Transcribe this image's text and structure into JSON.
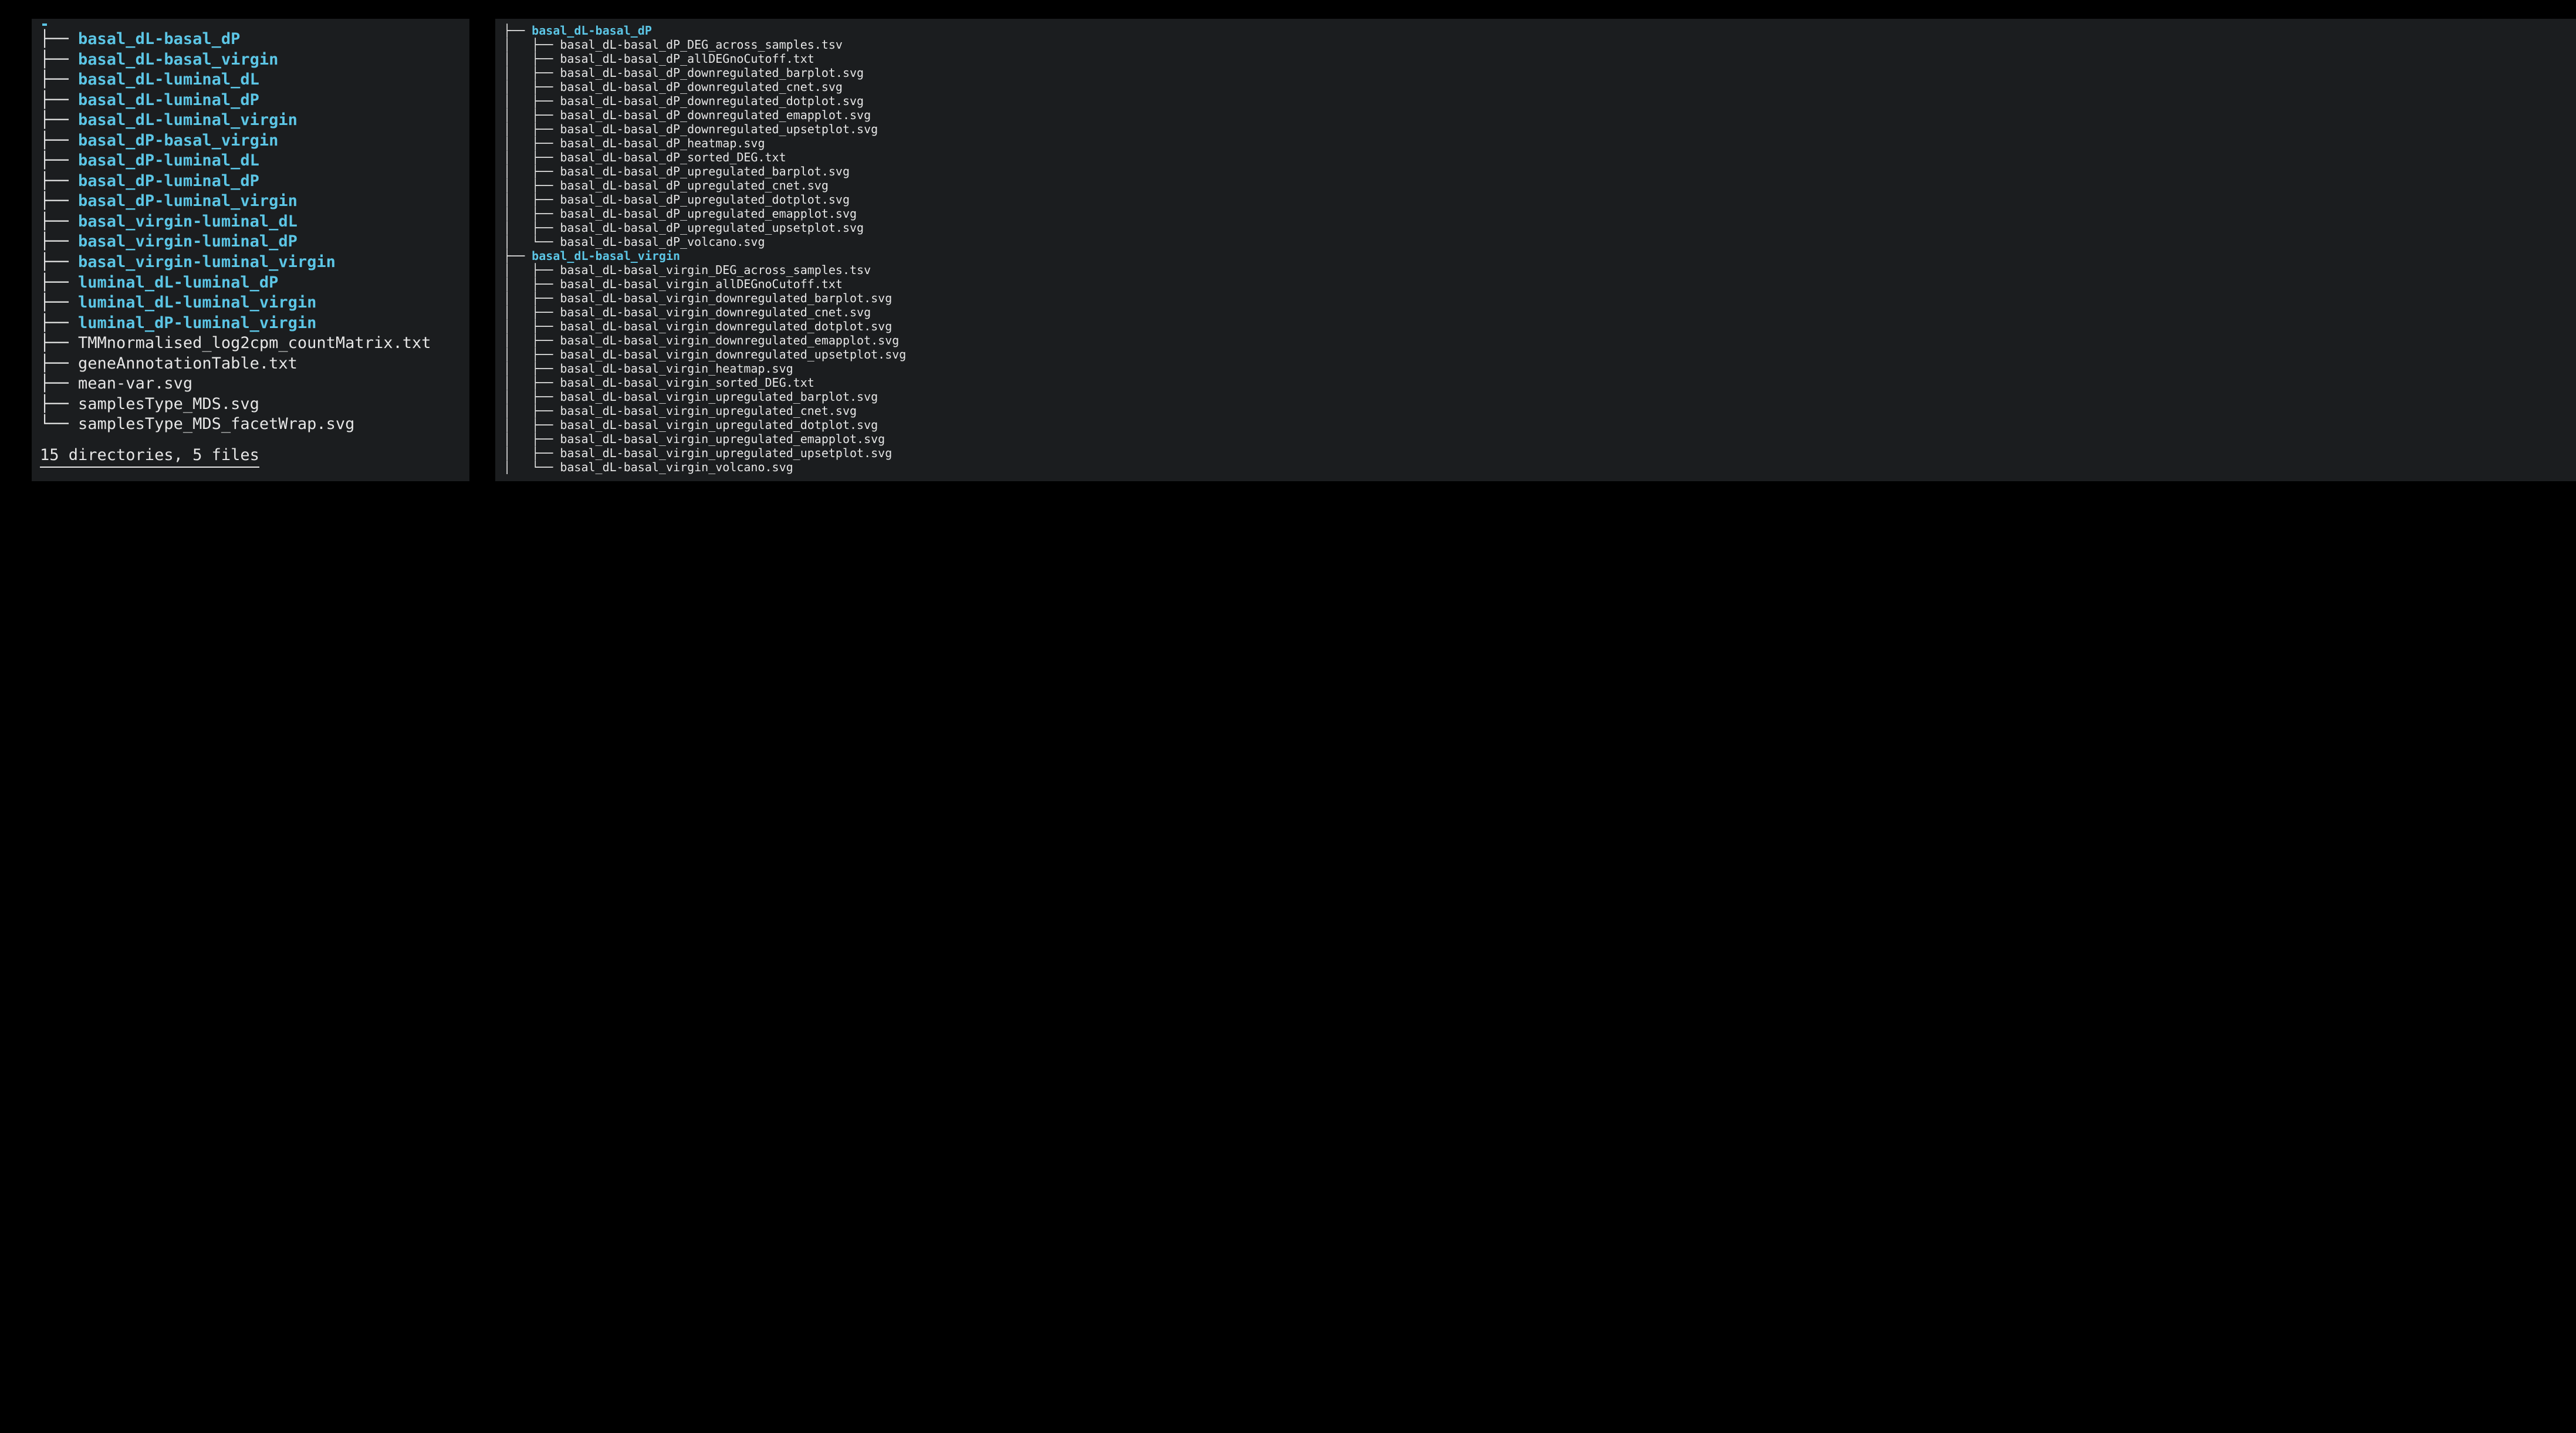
{
  "left": {
    "rootHint": ".",
    "items": [
      {
        "prefix": "├── ",
        "name": "basal_dL-basal_dP",
        "type": "dir"
      },
      {
        "prefix": "├── ",
        "name": "basal_dL-basal_virgin",
        "type": "dir"
      },
      {
        "prefix": "├── ",
        "name": "basal_dL-luminal_dL",
        "type": "dir"
      },
      {
        "prefix": "├── ",
        "name": "basal_dL-luminal_dP",
        "type": "dir"
      },
      {
        "prefix": "├── ",
        "name": "basal_dL-luminal_virgin",
        "type": "dir"
      },
      {
        "prefix": "├── ",
        "name": "basal_dP-basal_virgin",
        "type": "dir"
      },
      {
        "prefix": "├── ",
        "name": "basal_dP-luminal_dL",
        "type": "dir"
      },
      {
        "prefix": "├── ",
        "name": "basal_dP-luminal_dP",
        "type": "dir"
      },
      {
        "prefix": "├── ",
        "name": "basal_dP-luminal_virgin",
        "type": "dir"
      },
      {
        "prefix": "├── ",
        "name": "basal_virgin-luminal_dL",
        "type": "dir"
      },
      {
        "prefix": "├── ",
        "name": "basal_virgin-luminal_dP",
        "type": "dir"
      },
      {
        "prefix": "├── ",
        "name": "basal_virgin-luminal_virgin",
        "type": "dir"
      },
      {
        "prefix": "├── ",
        "name": "luminal_dL-luminal_dP",
        "type": "dir"
      },
      {
        "prefix": "├── ",
        "name": "luminal_dL-luminal_virgin",
        "type": "dir"
      },
      {
        "prefix": "├── ",
        "name": "luminal_dP-luminal_virgin",
        "type": "dir"
      },
      {
        "prefix": "├── ",
        "name": "TMMnormalised_log2cpm_countMatrix.txt",
        "type": "file"
      },
      {
        "prefix": "├── ",
        "name": "geneAnnotationTable.txt",
        "type": "file"
      },
      {
        "prefix": "├── ",
        "name": "mean-var.svg",
        "type": "file"
      },
      {
        "prefix": "├── ",
        "name": "samplesType_MDS.svg",
        "type": "file"
      },
      {
        "prefix": "└── ",
        "name": "samplesType_MDS_facetWrap.svg",
        "type": "file"
      }
    ],
    "summary": "15 directories, 5 files"
  },
  "right": {
    "groups": [
      {
        "dirPrefix": "├── ",
        "dirName": "basal_dL-basal_dP",
        "files": [
          "basal_dL-basal_dP_DEG_across_samples.tsv",
          "basal_dL-basal_dP_allDEGnoCutoff.txt",
          "basal_dL-basal_dP_downregulated_barplot.svg",
          "basal_dL-basal_dP_downregulated_cnet.svg",
          "basal_dL-basal_dP_downregulated_dotplot.svg",
          "basal_dL-basal_dP_downregulated_emapplot.svg",
          "basal_dL-basal_dP_downregulated_upsetplot.svg",
          "basal_dL-basal_dP_heatmap.svg",
          "basal_dL-basal_dP_sorted_DEG.txt",
          "basal_dL-basal_dP_upregulated_barplot.svg",
          "basal_dL-basal_dP_upregulated_cnet.svg",
          "basal_dL-basal_dP_upregulated_dotplot.svg",
          "basal_dL-basal_dP_upregulated_emapplot.svg",
          "basal_dL-basal_dP_upregulated_upsetplot.svg",
          "basal_dL-basal_dP_volcano.svg"
        ]
      },
      {
        "dirPrefix": "├── ",
        "dirName": "basal_dL-basal_virgin",
        "files": [
          "basal_dL-basal_virgin_DEG_across_samples.tsv",
          "basal_dL-basal_virgin_allDEGnoCutoff.txt",
          "basal_dL-basal_virgin_downregulated_barplot.svg",
          "basal_dL-basal_virgin_downregulated_cnet.svg",
          "basal_dL-basal_virgin_downregulated_dotplot.svg",
          "basal_dL-basal_virgin_downregulated_emapplot.svg",
          "basal_dL-basal_virgin_downregulated_upsetplot.svg",
          "basal_dL-basal_virgin_heatmap.svg",
          "basal_dL-basal_virgin_sorted_DEG.txt",
          "basal_dL-basal_virgin_upregulated_barplot.svg",
          "basal_dL-basal_virgin_upregulated_cnet.svg",
          "basal_dL-basal_virgin_upregulated_dotplot.svg",
          "basal_dL-basal_virgin_upregulated_emapplot.svg",
          "basal_dL-basal_virgin_upregulated_upsetplot.svg",
          "basal_dL-basal_virgin_volcano.svg"
        ]
      }
    ]
  }
}
